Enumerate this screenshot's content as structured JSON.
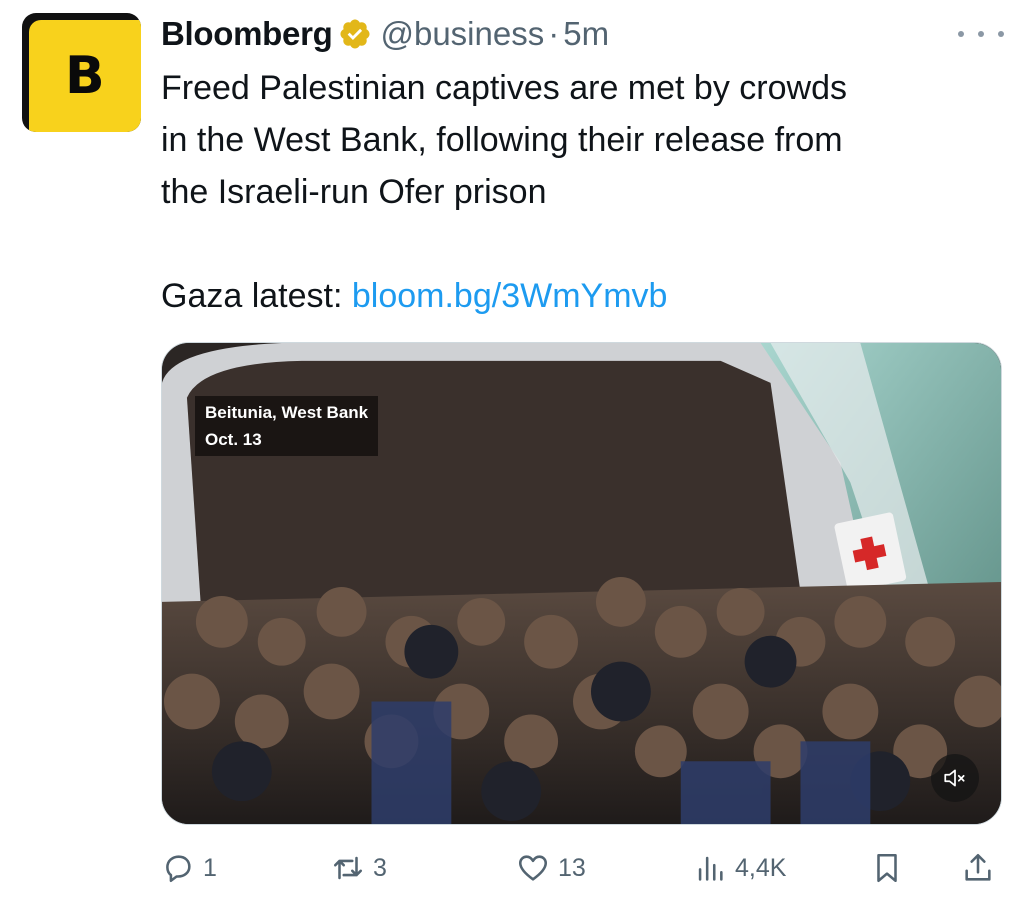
{
  "tweet": {
    "avatar_letter": "B",
    "author_name": "Bloomberg",
    "handle": "@business",
    "separator": "·",
    "time": "5m",
    "text_line1": "Freed Palestinian captives are met by crowds",
    "text_line2": "in the West Bank, following their release from",
    "text_line3": "the Israeli-run Ofer prison",
    "latest_label": "Gaza latest:",
    "link": "bloom.bg/3WmYmvb"
  },
  "media": {
    "caption_line1": "Beitunia, West Bank",
    "caption_line2": "Oct. 13",
    "mute_icon": "speaker-muted-icon"
  },
  "actions": {
    "replies": "1",
    "reposts": "3",
    "likes": "13",
    "views": "4,4K"
  },
  "colors": {
    "brand_yellow": "#f8d21c",
    "link_blue": "#1d9bf0",
    "verified_gold": "#e2b719",
    "muted_text": "#536471"
  },
  "icons": [
    "more-icon",
    "verified-badge-icon",
    "reply-icon",
    "repost-icon",
    "like-icon",
    "views-icon",
    "bookmark-icon",
    "share-icon"
  ]
}
